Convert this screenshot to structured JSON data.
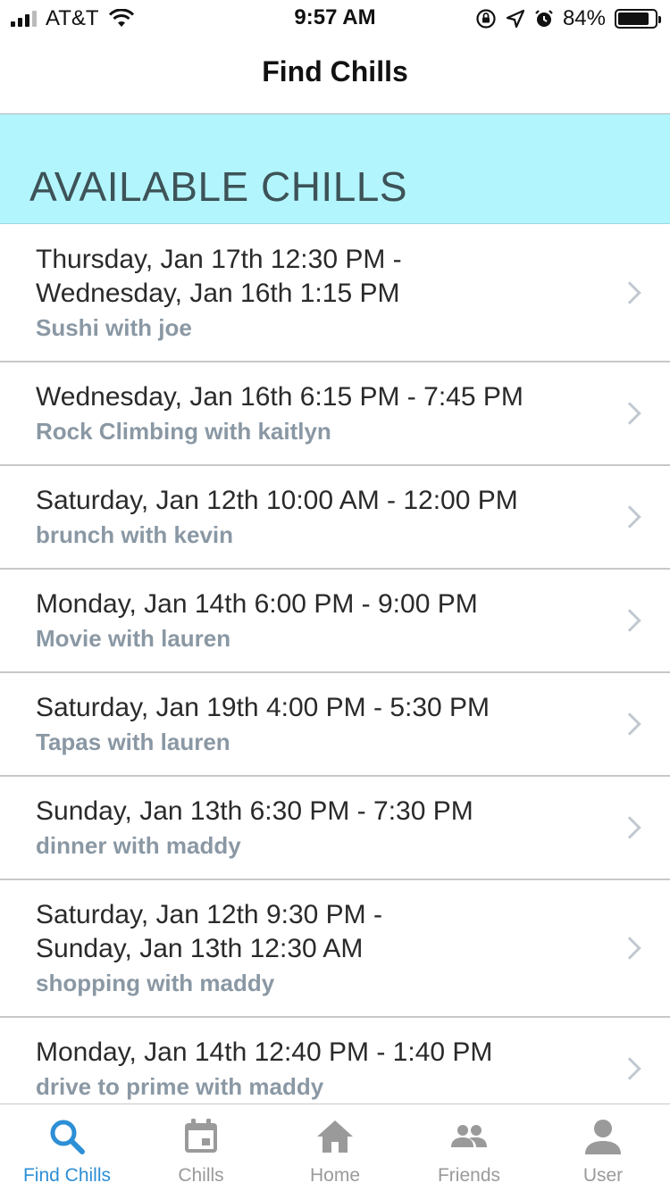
{
  "status_bar": {
    "carrier": "AT&T",
    "time": "9:57 AM",
    "battery_percent": "84%",
    "battery_level": 0.84,
    "icons": [
      "signal-icon",
      "wifi-icon",
      "orientation-lock-icon",
      "location-icon",
      "alarm-icon",
      "battery-icon"
    ]
  },
  "nav": {
    "title": "Find Chills"
  },
  "section": {
    "title": "AVAILABLE CHILLS"
  },
  "chills": [
    {
      "time_line1": "Thursday, Jan 17th 12:30 PM -",
      "time_line2": "Wednesday, Jan 16th 1:15 PM",
      "title": "Sushi with joe"
    },
    {
      "time_line1": "Wednesday, Jan 16th 6:15 PM - 7:45 PM",
      "time_line2": "",
      "title": "Rock Climbing with kaitlyn"
    },
    {
      "time_line1": "Saturday, Jan 12th 10:00 AM - 12:00 PM",
      "time_line2": "",
      "title": "brunch with kevin"
    },
    {
      "time_line1": "Monday, Jan 14th 6:00 PM - 9:00 PM",
      "time_line2": "",
      "title": "Movie with lauren"
    },
    {
      "time_line1": "Saturday, Jan 19th 4:00 PM - 5:30 PM",
      "time_line2": "",
      "title": "Tapas with lauren"
    },
    {
      "time_line1": "Sunday, Jan 13th 6:30 PM - 7:30 PM",
      "time_line2": "",
      "title": "dinner with maddy"
    },
    {
      "time_line1": "Saturday, Jan 12th 9:30 PM -",
      "time_line2": "Sunday, Jan 13th 12:30 AM",
      "title": "shopping with maddy"
    },
    {
      "time_line1": "Monday, Jan 14th 12:40 PM - 1:40 PM",
      "time_line2": "",
      "title": "drive to prime with maddy"
    }
  ],
  "tabs": [
    {
      "label": "Find Chills",
      "icon": "search-icon",
      "active": true
    },
    {
      "label": "Chills",
      "icon": "calendar-icon",
      "active": false
    },
    {
      "label": "Home",
      "icon": "home-icon",
      "active": false
    },
    {
      "label": "Friends",
      "icon": "friends-icon",
      "active": false
    },
    {
      "label": "User",
      "icon": "user-icon",
      "active": false
    }
  ],
  "colors": {
    "accent": "#2d8fd5",
    "section_bg": "#b3f5fc",
    "section_text": "#3d5358",
    "subtitle": "#8a98a4",
    "tab_inactive": "#9a9a9a"
  }
}
